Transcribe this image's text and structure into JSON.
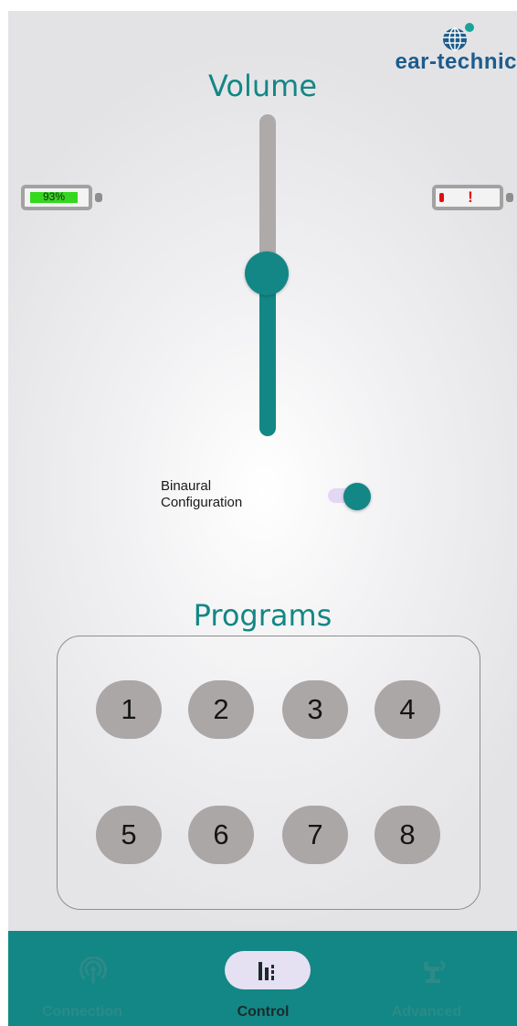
{
  "brand": {
    "logo_text": "ear-technic",
    "logo_icon": "globe-icon"
  },
  "volume": {
    "title": "Volume",
    "level_fraction": 0.49
  },
  "batteries": {
    "left": {
      "percent_label": "93%",
      "level": 0.93,
      "fill_color": "#35d81f"
    },
    "right": {
      "alert_text": "!",
      "level": 0.05,
      "fill_color": "#e01010"
    }
  },
  "binaural": {
    "label_line1": "Binaural",
    "label_line2": "Configuration",
    "enabled": true
  },
  "programs": {
    "title": "Programs",
    "buttons": [
      "1",
      "2",
      "3",
      "4",
      "5",
      "6",
      "7",
      "8"
    ]
  },
  "nav": {
    "items": [
      {
        "label": "Connection",
        "icon": "broadcast-icon",
        "active": false
      },
      {
        "label": "Control",
        "icon": "equalizer-icon",
        "active": true
      },
      {
        "label": "Advanced",
        "icon": "robot-arm-icon",
        "active": false
      }
    ]
  },
  "colors": {
    "accent": "#138785",
    "button_gray": "#aca7a7",
    "track_gray": "#aeaaaa",
    "nav_pill": "#e6e0f3"
  }
}
